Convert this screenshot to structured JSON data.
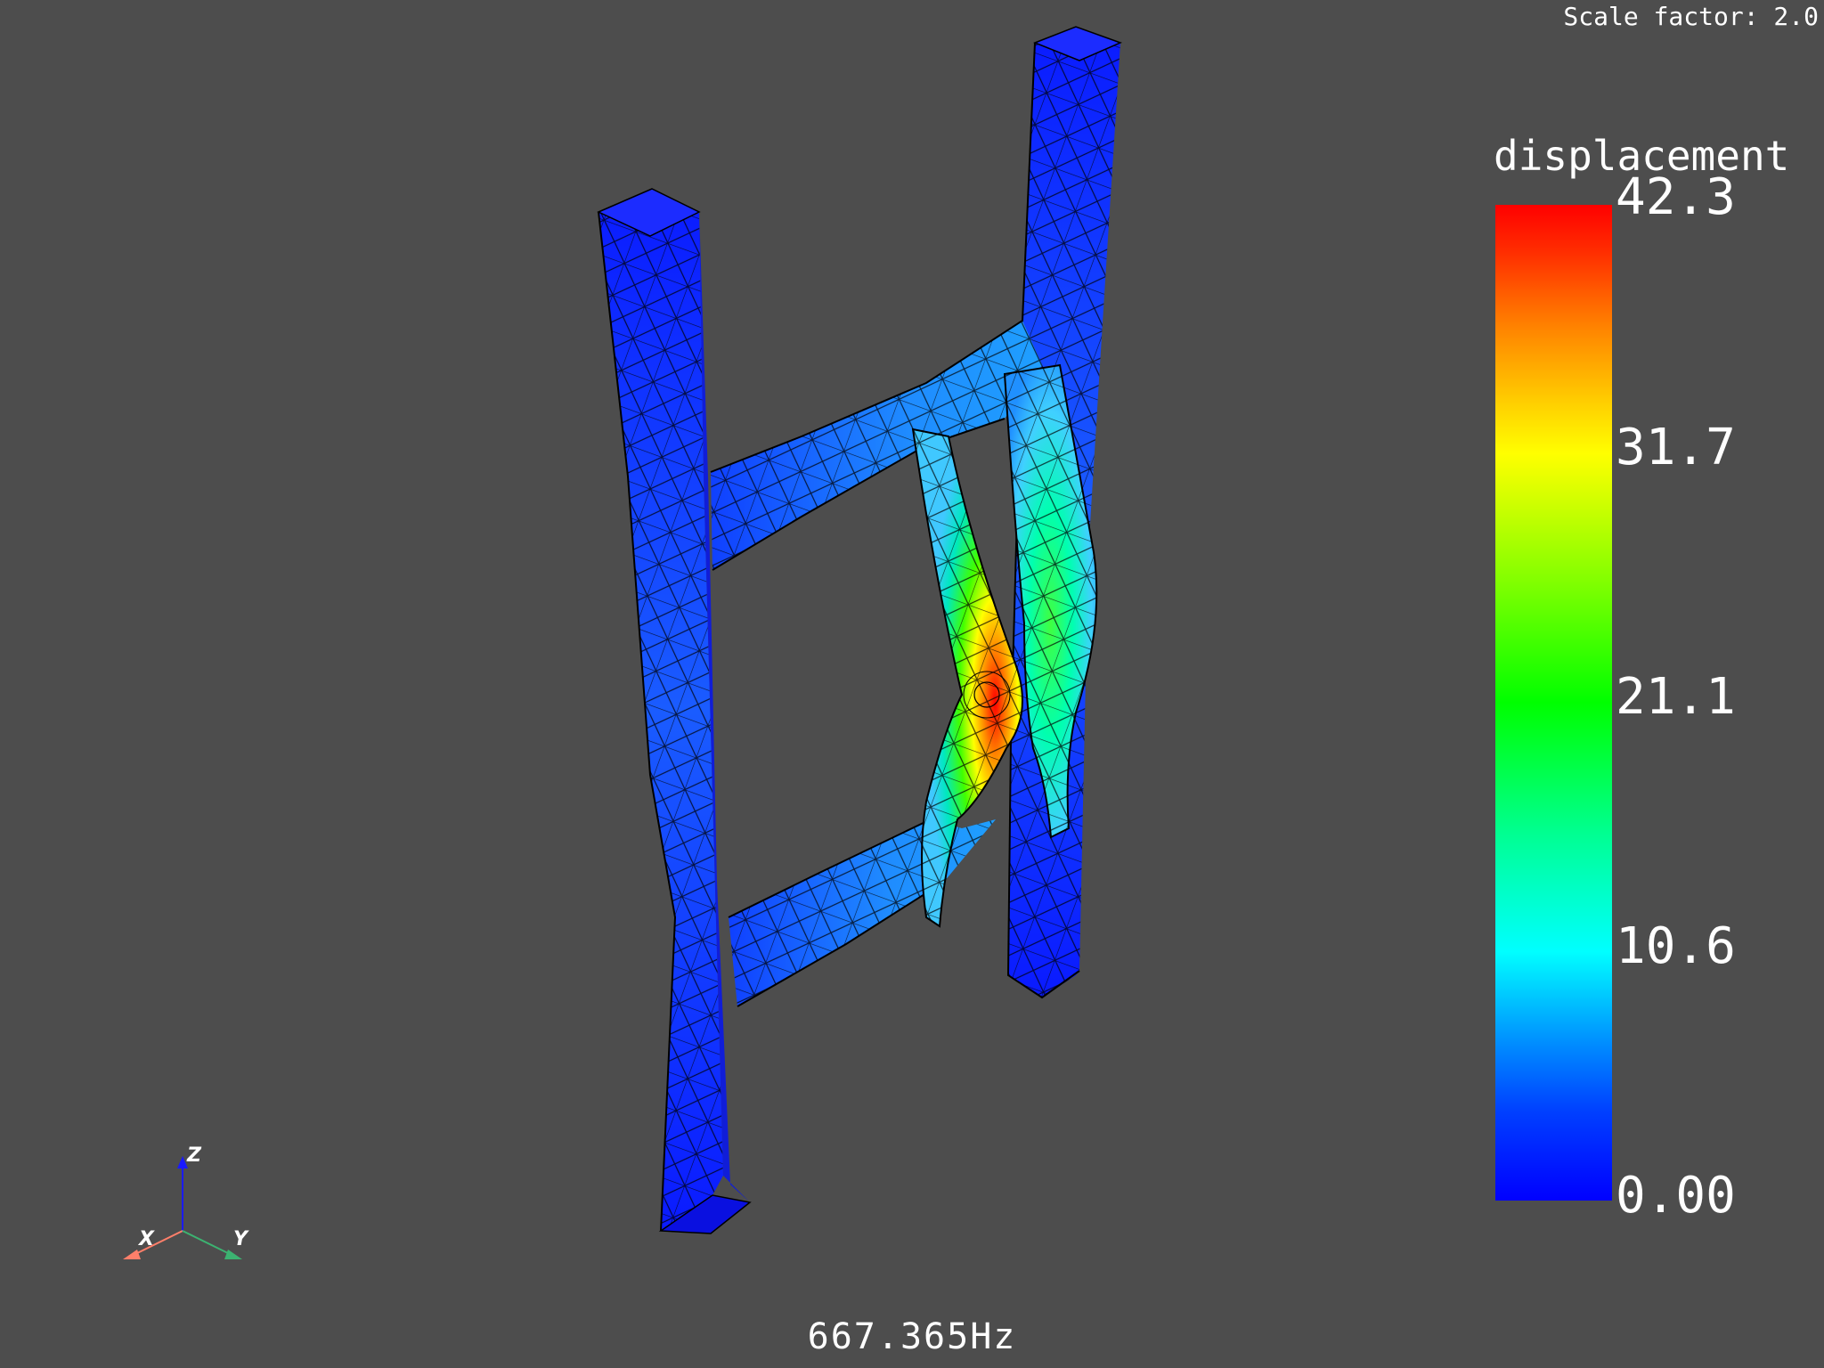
{
  "header": {
    "scale_factor": "Scale factor: 2.0"
  },
  "legend": {
    "title": "displacement",
    "ticks": [
      "42.3",
      "31.7",
      "21.1",
      "10.6",
      "0.00"
    ],
    "max": 42.3,
    "min": 0.0,
    "colormap": "rainbow (blue-cyan-green-yellow-red)"
  },
  "footer": {
    "frequency": "667.365Hz"
  },
  "axes": {
    "z": "Z",
    "x": "X",
    "y": "Y",
    "colors": {
      "x": "#ff7f6a",
      "y": "#3cb371",
      "z": "#1a1aff"
    }
  },
  "colors": {
    "background": "#4d4d4d",
    "low": "#0000ff",
    "high": "#ff0000"
  }
}
